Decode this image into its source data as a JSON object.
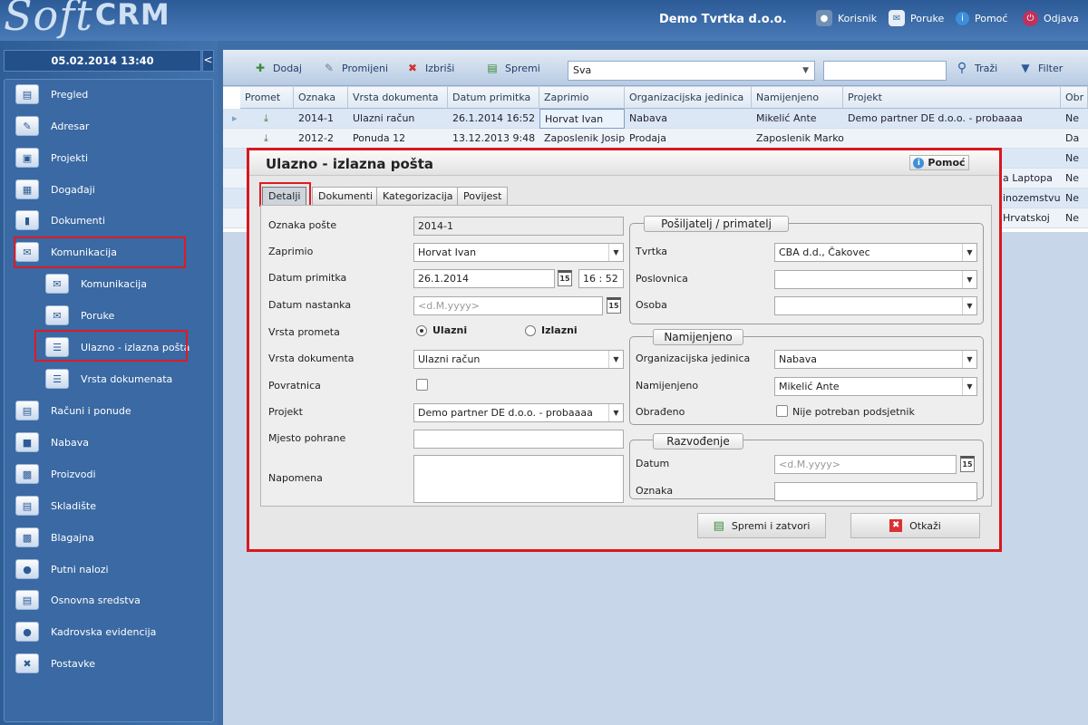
{
  "app": {
    "logo_soft": "Soft",
    "logo_crm": "CRM",
    "company": "Demo Tvrtka d.o.o."
  },
  "topmenu": [
    {
      "label": "Korisnik",
      "icon": "user-icon"
    },
    {
      "label": "Poruke",
      "icon": "mail-icon"
    },
    {
      "label": "Pomoć",
      "icon": "info-icon"
    },
    {
      "label": "Odjava",
      "icon": "power-icon"
    }
  ],
  "sidebar": {
    "datetime": "05.02.2014 13:40",
    "collapse": "<",
    "items": [
      {
        "label": "Pregled"
      },
      {
        "label": "Adresar"
      },
      {
        "label": "Projekti"
      },
      {
        "label": "Događaji"
      },
      {
        "label": "Dokumenti"
      },
      {
        "label": "Komunikacija"
      },
      {
        "label": "Komunikacija"
      },
      {
        "label": "Poruke"
      },
      {
        "label": "Ulazno - izlazna pošta"
      },
      {
        "label": "Vrsta dokumenata"
      },
      {
        "label": "Računi i ponude"
      },
      {
        "label": "Nabava"
      },
      {
        "label": "Proizvodi"
      },
      {
        "label": "Skladište"
      },
      {
        "label": "Blagajna"
      },
      {
        "label": "Putni nalozi"
      },
      {
        "label": "Osnovna sredstva"
      },
      {
        "label": "Kadrovska evidencija"
      },
      {
        "label": "Postavke"
      }
    ]
  },
  "toolbar": {
    "add": "Dodaj",
    "edit": "Promijeni",
    "delete": "Izbriši",
    "save": "Spremi",
    "filter_value": "Sva",
    "search": "Traži",
    "filter": "Filter"
  },
  "grid": {
    "columns": [
      "Promet",
      "Oznaka",
      "Vrsta dokumenta",
      "Datum primitka",
      "Zaprimio",
      "Organizacijska jedinica",
      "Namijenjeno",
      "Projekt",
      "Obr"
    ],
    "rows": [
      [
        "",
        "2014-1",
        "Ulazni račun",
        "26.1.2014 16:52",
        "Horvat Ivan",
        "Nabava",
        "Mikelić Ante",
        "Demo partner DE d.o.o. - probaaaa",
        "Ne"
      ],
      [
        "",
        "2012-2",
        "Ponuda 12",
        "13.12.2013 9:48",
        "Zaposlenik Josip",
        "Prodaja",
        "Zaposlenik Marko",
        "",
        "Da"
      ],
      [
        "",
        "",
        "",
        "",
        "",
        "",
        "",
        "",
        "Ne"
      ],
      [
        "",
        "",
        "",
        "",
        "",
        "",
        "",
        "a Laptopa",
        "Ne"
      ],
      [
        "",
        "",
        "",
        "",
        "",
        "",
        "",
        "inozemstvu",
        "Ne"
      ],
      [
        "",
        "",
        "",
        "",
        "",
        "",
        "",
        "Hrvatskoj",
        "Ne"
      ]
    ]
  },
  "dialog": {
    "title": "Ulazno - izlazna pošta",
    "help": "Pomoć",
    "tabs": [
      "Detalji",
      "Dokumenti",
      "Kategorizacija",
      "Povijest"
    ],
    "left": {
      "oznaka_label": "Oznaka pošte",
      "oznaka_value": "2014-1",
      "zaprimio_label": "Zaprimio",
      "zaprimio_value": "Horvat Ivan",
      "datum_primitka_label": "Datum primitka",
      "datum_primitka_value": "26.1.2014",
      "vrijeme_value": "16 : 52",
      "datum_nastanka_label": "Datum nastanka",
      "datum_nastanka_placeholder": "<d.M.yyyy>",
      "vrsta_prometa_label": "Vrsta prometa",
      "ulazni": "Ulazni",
      "izlazni": "Izlazni",
      "vrsta_dokumenta_label": "Vrsta dokumenta",
      "vrsta_dokumenta_value": "Ulazni račun",
      "povratnica_label": "Povratnica",
      "projekt_label": "Projekt",
      "projekt_value": "Demo partner DE d.o.o. - probaaaa",
      "mjesto_label": "Mjesto pohrane",
      "napomena_label": "Napomena"
    },
    "posiljatelj": {
      "title": "Pošiljatelj / primatelj",
      "tvrtka_label": "Tvrtka",
      "tvrtka_value": "CBA d.d., Čakovec",
      "poslovnica_label": "Poslovnica",
      "osoba_label": "Osoba"
    },
    "namijenjeno": {
      "title": "Namijenjeno",
      "org_label": "Organizacijska jedinica",
      "org_value": "Nabava",
      "nam_label": "Namijenjeno",
      "nam_value": "Mikelić Ante",
      "obradeno_label": "Obrađeno",
      "podsjetnik_label": "Nije potreban podsjetnik"
    },
    "razvodenje": {
      "title": "Razvođenje",
      "datum_label": "Datum",
      "datum_placeholder": "<d.M.yyyy>",
      "oznaka_label": "Oznaka"
    },
    "cal_day": "15",
    "save_close": "Spremi i zatvori",
    "cancel": "Otkaži"
  }
}
